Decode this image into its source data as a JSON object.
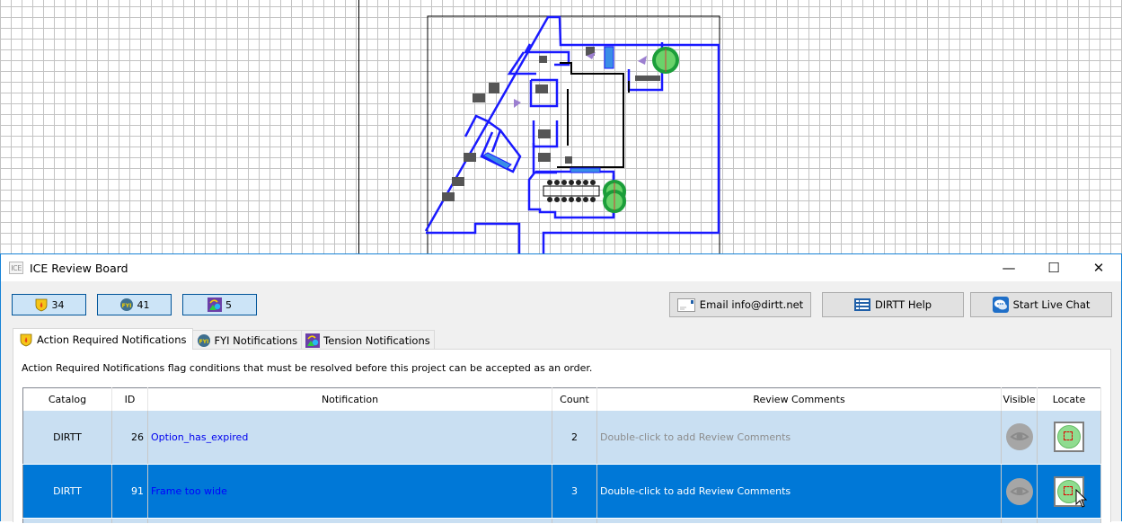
{
  "window": {
    "title": "ICE Review Board",
    "app_icon_text": "ICE",
    "controls": {
      "minimize": "—",
      "maximize": "☐",
      "close": "✕"
    }
  },
  "summary": [
    {
      "icon": "action-required-shield-icon",
      "count": "34"
    },
    {
      "icon": "fyi-globe-icon",
      "count": "41"
    },
    {
      "icon": "tension-shapes-icon",
      "count": "5"
    }
  ],
  "actions": {
    "email": "Email info@dirtt.net",
    "help": "DIRTT Help",
    "chat": "Start Live Chat"
  },
  "tabs": [
    {
      "label": "Action Required Notifications",
      "active": true
    },
    {
      "label": "FYI Notifications",
      "active": false
    },
    {
      "label": "Tension Notifications",
      "active": false
    }
  ],
  "panel": {
    "description": "Action Required Notifications flag conditions that must be resolved before this project can be accepted as an order."
  },
  "table": {
    "columns": [
      "Catalog",
      "ID",
      "Notification",
      "Count",
      "Review Comments",
      "Visible",
      "Locate"
    ],
    "rows": [
      {
        "catalog": "DIRTT",
        "id": "26",
        "notification": "Option_has_expired",
        "count": "2",
        "comments": "Double-click to add Review Comments",
        "selected": false
      },
      {
        "catalog": "DIRTT",
        "id": "91",
        "notification": "Frame too wide",
        "count": "3",
        "comments": "Double-click to add Review Comments",
        "selected": true
      }
    ]
  },
  "colors": {
    "selection": "#0078d7",
    "row_background": "#c9dff2",
    "window_border": "#1883d7",
    "plan_walls": "#1a1aff"
  }
}
